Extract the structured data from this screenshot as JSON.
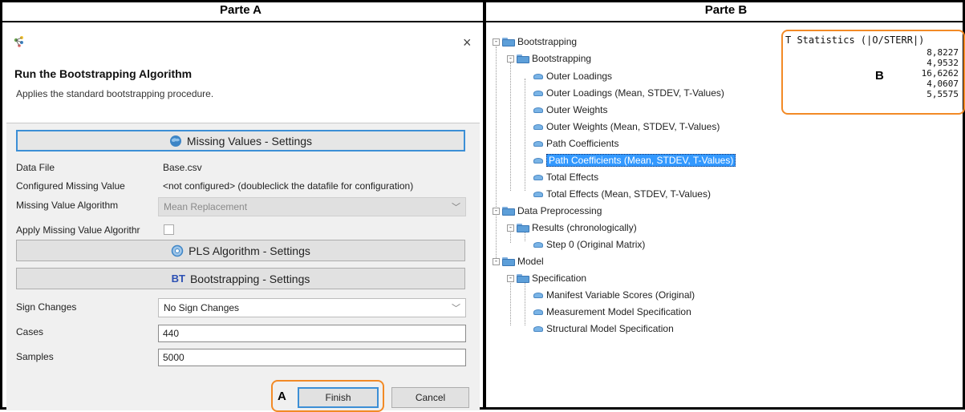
{
  "part_a": {
    "title": "Parte A",
    "dialog": {
      "title": "Run the Bootstrapping Algorithm",
      "subtitle": "Applies the standard bootstrapping procedure.",
      "close_label": "×"
    },
    "missing_values": {
      "section_label": "Missing Values - Settings",
      "data_file_label": "Data File",
      "data_file_value": "Base.csv",
      "configured_label": "Configured Missing Value",
      "configured_value": "<not configured> (doubleclick the datafile for configuration)",
      "algorithm_label": "Missing Value Algorithm",
      "algorithm_value": "Mean Replacement",
      "apply_label": "Apply Missing Value Algorithr"
    },
    "pls_section_label": "PLS Algorithm - Settings",
    "bootstrapping": {
      "section_prefix": "BT",
      "section_label": "Bootstrapping - Settings",
      "sign_changes_label": "Sign Changes",
      "sign_changes_value": "No Sign Changes",
      "cases_label": "Cases",
      "cases_value": "440",
      "samples_label": "Samples",
      "samples_value": "5000"
    },
    "marker": "A",
    "buttons": {
      "finish": "Finish",
      "cancel": "Cancel"
    }
  },
  "part_b": {
    "title": "Parte B",
    "tree": [
      {
        "label": "Bootstrapping",
        "level": 0,
        "type": "folder"
      },
      {
        "label": "Bootstrapping",
        "level": 1,
        "type": "folder"
      },
      {
        "label": "Outer Loadings",
        "level": 2,
        "type": "leaf"
      },
      {
        "label": "Outer Loadings (Mean, STDEV, T-Values)",
        "level": 2,
        "type": "leaf"
      },
      {
        "label": "Outer Weights",
        "level": 2,
        "type": "leaf"
      },
      {
        "label": "Outer Weights (Mean, STDEV, T-Values)",
        "level": 2,
        "type": "leaf"
      },
      {
        "label": "Path Coefficients",
        "level": 2,
        "type": "leaf"
      },
      {
        "label": "Path Coefficients (Mean, STDEV, T-Values)",
        "level": 2,
        "type": "leaf",
        "selected": true
      },
      {
        "label": "Total Effects",
        "level": 2,
        "type": "leaf"
      },
      {
        "label": "Total Effects (Mean, STDEV, T-Values)",
        "level": 2,
        "type": "leaf"
      },
      {
        "label": "Data Preprocessing",
        "level": 0,
        "type": "folder"
      },
      {
        "label": "Results (chronologically)",
        "level": 1,
        "type": "folder"
      },
      {
        "label": "Step 0 (Original Matrix)",
        "level": 2,
        "type": "leaf"
      },
      {
        "label": "Model",
        "level": 0,
        "type": "folder"
      },
      {
        "label": "Specification",
        "level": 1,
        "type": "folder"
      },
      {
        "label": "Manifest Variable Scores (Original)",
        "level": 2,
        "type": "leaf"
      },
      {
        "label": "Measurement Model Specification",
        "level": 2,
        "type": "leaf"
      },
      {
        "label": "Structural Model Specification",
        "level": 2,
        "type": "leaf"
      }
    ],
    "stats": {
      "title": "T Statistics (|O/STERR|)",
      "values": [
        "8,8227",
        "4,9532",
        "16,6262",
        "4,0607",
        "5,5575"
      ],
      "marker": "B"
    }
  },
  "colors": {
    "accent": "#3c8fd6",
    "highlight": "#f28a26",
    "selection": "#3399ff"
  }
}
